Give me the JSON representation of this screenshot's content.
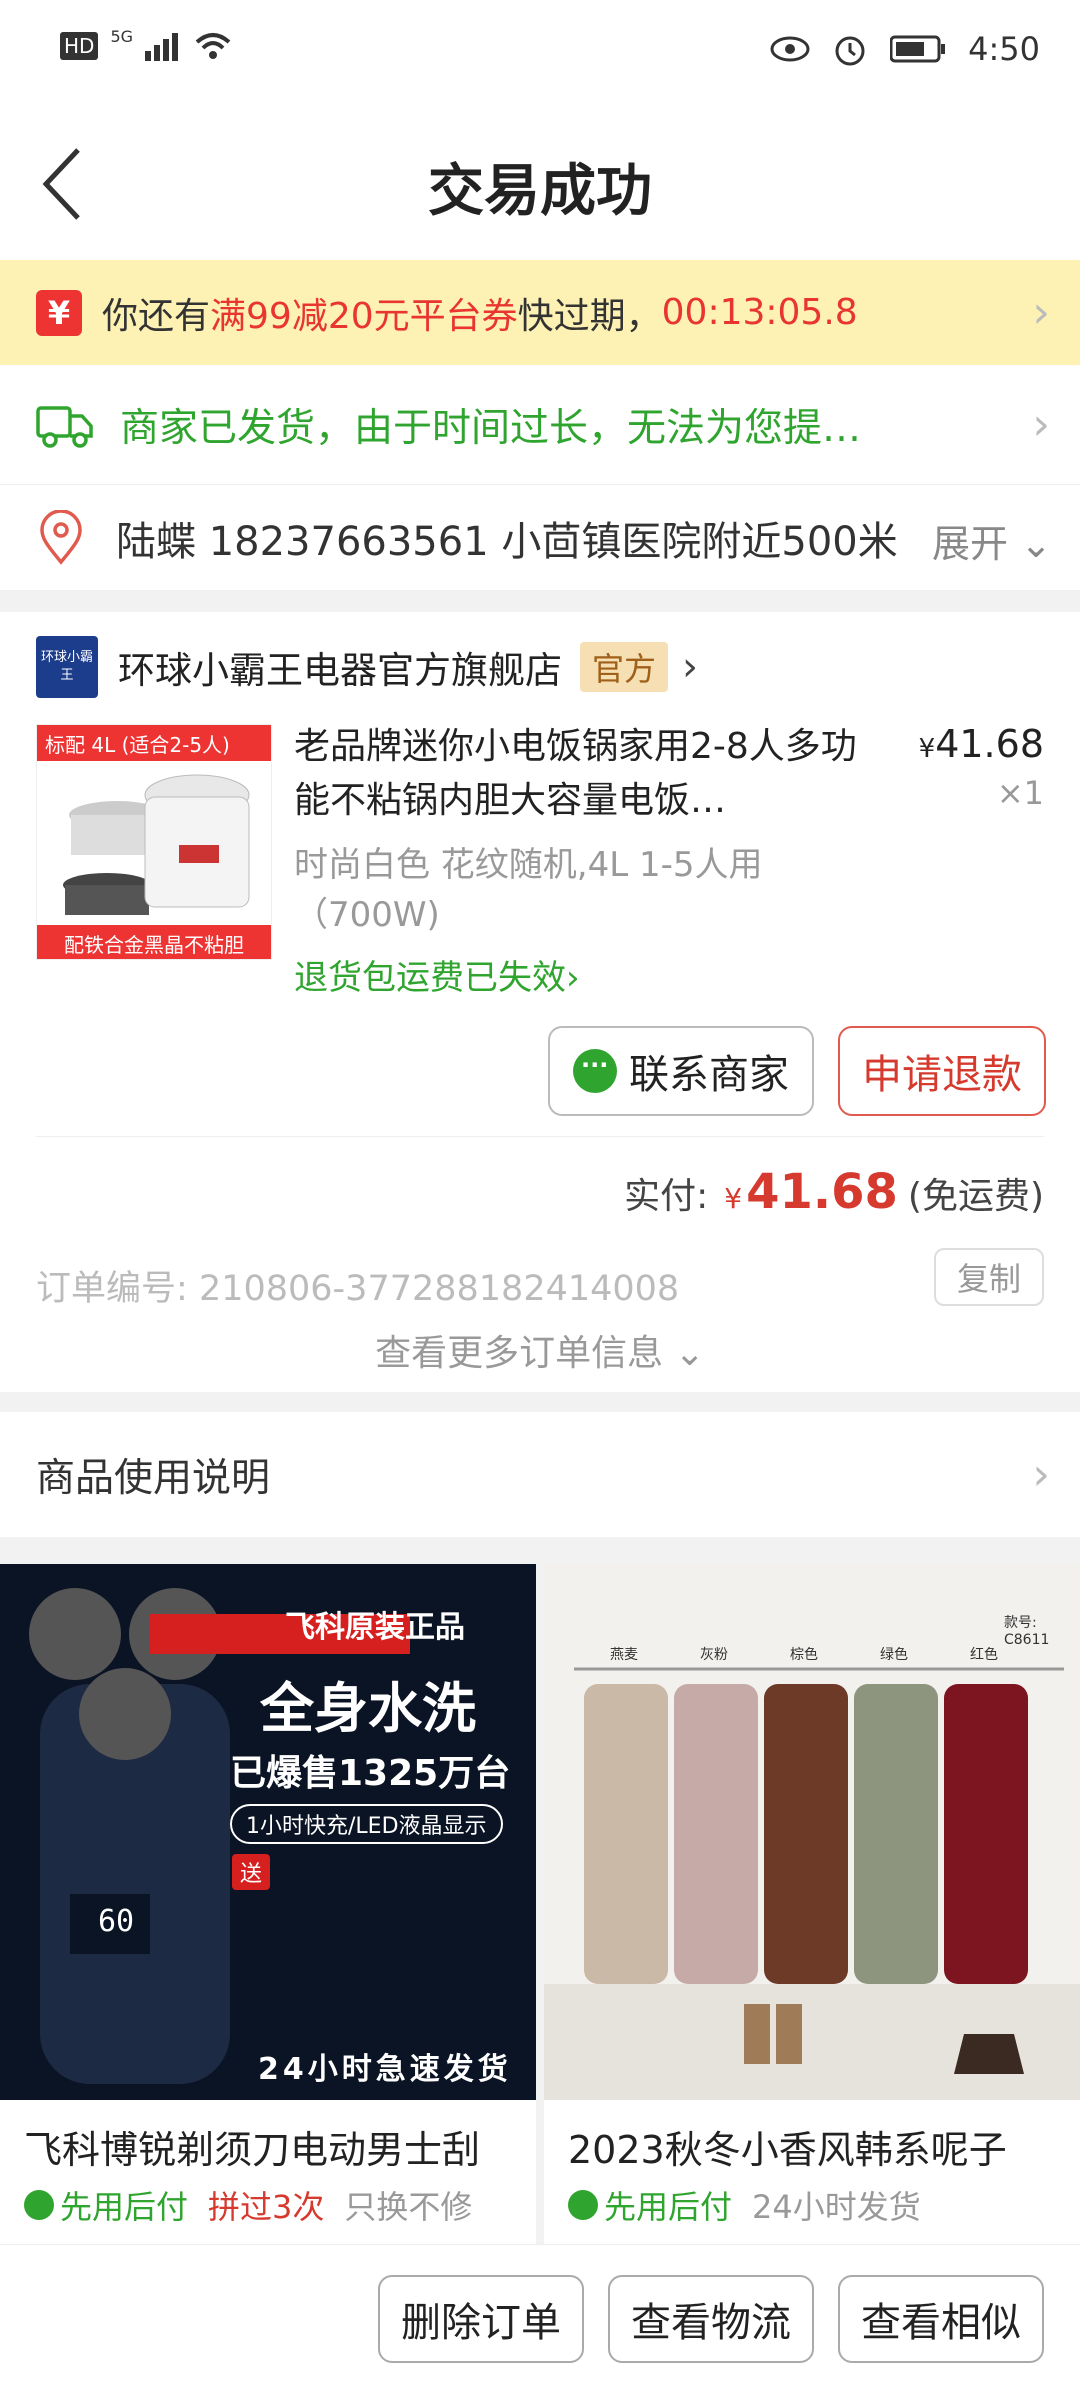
{
  "status_bar": {
    "left": [
      "HD",
      "5G"
    ],
    "time": "4:50"
  },
  "nav": {
    "title": "交易成功"
  },
  "coupon": {
    "icon": "¥",
    "prefix": "你还有",
    "highlight": "满99减20元平台券",
    "middle": "快过期，",
    "countdown": "00:13:05.8"
  },
  "shipping": {
    "text": "商家已发货，由于时间过长，无法为您提…"
  },
  "address": {
    "text": "陆蝶  18237663561  小茴镇医院附近500米",
    "expand_label": "展开"
  },
  "shop": {
    "logo_text": "环球小霸王",
    "name": "环球小霸王电器官方旗舰店",
    "badge": "官方"
  },
  "product": {
    "img_tag_top": "标配 4L    (适合2-5人)",
    "img_tag_bottom": "配铁合金黑晶不粘胆",
    "title": "老品牌迷你小电饭锅家用2-8人多功能不粘锅内胆大容量电饭…",
    "price_symbol": "¥",
    "price": "41.68",
    "qty": "×1",
    "spec": "时尚白色 花纹随机,4L 1-5人用（700W)",
    "return_note": "退货包运费已失效"
  },
  "actions": {
    "contact_label": "联系商家",
    "refund_label": "申请退款"
  },
  "payment": {
    "label": "实付:",
    "symbol": "¥",
    "amount": "41.68",
    "note": "(免运费)"
  },
  "order": {
    "number_label": "订单编号:",
    "number": "210806-377288182414008",
    "copy_label": "复制",
    "more_label": "查看更多订单信息"
  },
  "usage": {
    "label": "商品使用说明"
  },
  "recommendations": [
    {
      "title": "飞科博锐剃须刀电动男士刮",
      "tags": [
        "先用后付",
        "拼过3次",
        "只换不修"
      ],
      "img_text": [
        "飞科原装正品",
        "全身水洗",
        "已爆售1325万台",
        "1小时快充/LED液晶显示",
        "送",
        "24小时急速发货",
        "60"
      ]
    },
    {
      "title": "2023秋冬小香风韩系呢子",
      "tags": [
        "先用后付",
        "24小时发货"
      ],
      "img_text": [
        "款号: C8611",
        "燕麦",
        "灰粉",
        "棕色",
        "绿色",
        "红色"
      ]
    }
  ],
  "bottom_bar": {
    "delete_label": "删除订单",
    "logistics_label": "查看物流",
    "similar_label": "查看相似"
  },
  "colors": {
    "accent_red": "#d63a2e",
    "green": "#2fa52f",
    "coupon_bg": "#fdf1b4"
  }
}
